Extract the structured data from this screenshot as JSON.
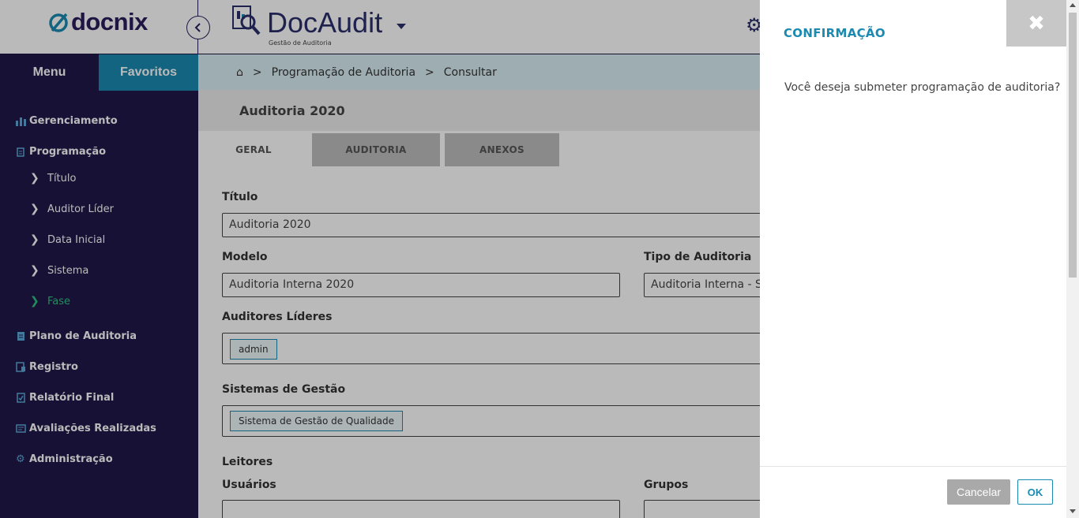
{
  "brand": {
    "name": "docnix",
    "accent": "#2b1e5c"
  },
  "app": {
    "name": "DocAudit",
    "subtitle": "Gestão de Auditoria"
  },
  "colors": {
    "sidebar": "#22184a",
    "accent": "#1a8ab0",
    "active_nav": "#2ec27e"
  },
  "sidebar": {
    "tabs": [
      {
        "label": "Menu"
      },
      {
        "label": "Favoritos"
      }
    ],
    "items": [
      {
        "label": "Gerenciamento",
        "icon": "bar-chart-icon"
      },
      {
        "label": "Programação",
        "icon": "calendar-icon"
      },
      {
        "label": "Plano de Auditoria",
        "icon": "document-icon"
      },
      {
        "label": "Registro",
        "icon": "register-icon"
      },
      {
        "label": "Relatório Final",
        "icon": "report-icon"
      },
      {
        "label": "Avaliações Realizadas",
        "icon": "evaluation-icon"
      },
      {
        "label": "Administração",
        "icon": "gear-icon"
      }
    ],
    "subitems": [
      {
        "label": "Título"
      },
      {
        "label": "Auditor Líder"
      },
      {
        "label": "Data Inicial"
      },
      {
        "label": "Sistema"
      },
      {
        "label": "Fase",
        "active": true
      }
    ]
  },
  "breadcrumb": {
    "items": [
      "Programação de Auditoria",
      "Consultar"
    ],
    "separator": ">"
  },
  "page": {
    "title": "Auditoria 2020"
  },
  "tabs": [
    {
      "label": "GERAL",
      "active": true
    },
    {
      "label": "AUDITORIA"
    },
    {
      "label": "ANEXOS"
    }
  ],
  "form": {
    "titulo": {
      "label": "Título",
      "value": "Auditoria 2020"
    },
    "modelo": {
      "label": "Modelo",
      "value": "Auditoria Interna 2020"
    },
    "tipo": {
      "label": "Tipo de Auditoria",
      "value": "Auditoria Interna - SG"
    },
    "auditores": {
      "label": "Auditores Líderes",
      "chips": [
        "admin"
      ]
    },
    "sistemas": {
      "label": "Sistemas de Gestão",
      "chips": [
        "Sistema de Gestão de Qualidade"
      ]
    },
    "leitores": {
      "label": "Leitores"
    },
    "usuarios": {
      "label": "Usuários"
    },
    "grupos": {
      "label": "Grupos"
    }
  },
  "dialog": {
    "title": "CONFIRMAÇÃO",
    "message": "Você deseja submeter programação de auditoria?",
    "cancel_label": "Cancelar",
    "ok_label": "OK"
  }
}
